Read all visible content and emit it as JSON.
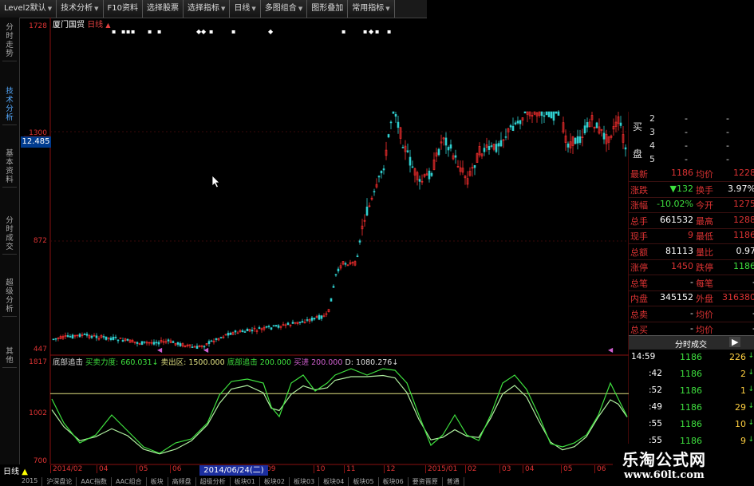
{
  "toolbar": {
    "items": [
      {
        "label": "Level2默认",
        "dropdown": true
      },
      {
        "label": "技术分析",
        "dropdown": true
      },
      {
        "label": "F10资料",
        "dropdown": false
      },
      {
        "label": "选择股票",
        "dropdown": false
      },
      {
        "label": "选择指标",
        "dropdown": true
      },
      {
        "label": "日线",
        "dropdown": true
      },
      {
        "label": "多图组合",
        "dropdown": true
      },
      {
        "label": "图形叠加",
        "dropdown": false
      },
      {
        "label": "常用指标",
        "dropdown": true
      }
    ]
  },
  "left_tabs": [
    "分时走势",
    "技术分析",
    "基本资料",
    "分时成交",
    "超级分析",
    "其他"
  ],
  "chart_header": {
    "stock_name": "厦门国贸",
    "period": "日线"
  },
  "price_axis": {
    "labels": [
      "1728",
      "1300",
      "872",
      "447"
    ],
    "current": "12.485"
  },
  "chart_data": [
    {
      "type": "candlestick",
      "ylim": [
        447,
        1728
      ],
      "ticks": [
        1728,
        1300,
        872,
        447
      ],
      "note": "daily K-line"
    },
    {
      "type": "line",
      "title": "底部追击",
      "params": [
        {
          "label": "买卖力度:",
          "value": "660.031"
        },
        {
          "label": "卖出区:",
          "value": "1500.000"
        },
        {
          "label": "底部追击",
          "value": "200.000"
        },
        {
          "label": "买进",
          "value": "200.000"
        },
        {
          "label": "D:",
          "value": "1080.276"
        }
      ],
      "ylim": [
        700,
        1817
      ],
      "ticks": [
        1817,
        1002,
        700
      ],
      "reference_line": 1500
    }
  ],
  "indicator_axis": {
    "labels": [
      "1817",
      "1002",
      "700"
    ]
  },
  "time_axis": {
    "labels": [
      "2014/02",
      "04",
      "05",
      "06",
      "09",
      "10",
      "11",
      "12",
      "2015/01",
      "02",
      "03",
      "04",
      "05",
      "06"
    ],
    "highlight": "2014/06/24(二)"
  },
  "bottom_tabs": [
    "2015",
    "沪深盘论",
    "AAC指数",
    "AAC组合",
    "板块",
    "高频盘",
    "超级分析",
    "板块01",
    "板块02",
    "板块03",
    "板块04",
    "板块05",
    "板块06",
    "要资晋原",
    "普通"
  ],
  "daily_label": "日线",
  "orderbook": {
    "side_label": [
      "买",
      "盘"
    ],
    "rows": [
      {
        "n": "2",
        "p": "-",
        "v": "-"
      },
      {
        "n": "3",
        "p": "-",
        "v": "-"
      },
      {
        "n": "4",
        "p": "-",
        "v": "-"
      },
      {
        "n": "5",
        "p": "-",
        "v": "-"
      }
    ]
  },
  "quote": [
    {
      "k1": "最新",
      "v1": "1186",
      "k2": "均价",
      "v2": "1228"
    },
    {
      "k1": "涨跌",
      "v1": "▼132",
      "k2": "换手",
      "v2": "3.97%"
    },
    {
      "k1": "涨幅",
      "v1": "-10.02%",
      "k2": "今开",
      "v2": "1275"
    },
    {
      "k1": "总手",
      "v1": "661532",
      "k2": "最高",
      "v2": "1288"
    },
    {
      "k1": "现手",
      "v1": "9",
      "k2": "最低",
      "v2": "1186"
    },
    {
      "k1": "总额",
      "v1": "81113",
      "k2": "量比",
      "v2": "0.97"
    },
    {
      "k1": "涨停",
      "v1": "1450",
      "k2": "跌停",
      "v2": "1186"
    },
    {
      "k1": "总笔",
      "v1": "-",
      "k2": "每笔",
      "v2": "-"
    },
    {
      "k1": "内盘",
      "v1": "345152",
      "k2": "外盘",
      "v2": "316380"
    },
    {
      "k1": "总卖",
      "v1": "-",
      "k2": "均价",
      "v2": "-"
    },
    {
      "k1": "总买",
      "v1": "-",
      "k2": "均价",
      "v2": "-"
    }
  ],
  "trades": {
    "title": "分时成交",
    "rows": [
      {
        "t": "14:59",
        "p": "1186",
        "v": "226",
        "dir": "down"
      },
      {
        "t": ":42",
        "p": "1186",
        "v": "2",
        "dir": "down"
      },
      {
        "t": ":52",
        "p": "1186",
        "v": "1",
        "dir": "down"
      },
      {
        "t": ":49",
        "p": "1186",
        "v": "29",
        "dir": "down"
      },
      {
        "t": ":55",
        "p": "1186",
        "v": "10",
        "dir": "down"
      },
      {
        "t": ":55",
        "p": "1186",
        "v": "9",
        "dir": "down"
      }
    ]
  },
  "watermark": {
    "title": "乐淘公式网",
    "url": "www.60lt.com"
  },
  "colors": {
    "up": "#ff3030",
    "down": "#30d0d0",
    "k_line": "#3ee03e",
    "d_line": "#b0f0a0",
    "ref_line": "#e0e080"
  }
}
